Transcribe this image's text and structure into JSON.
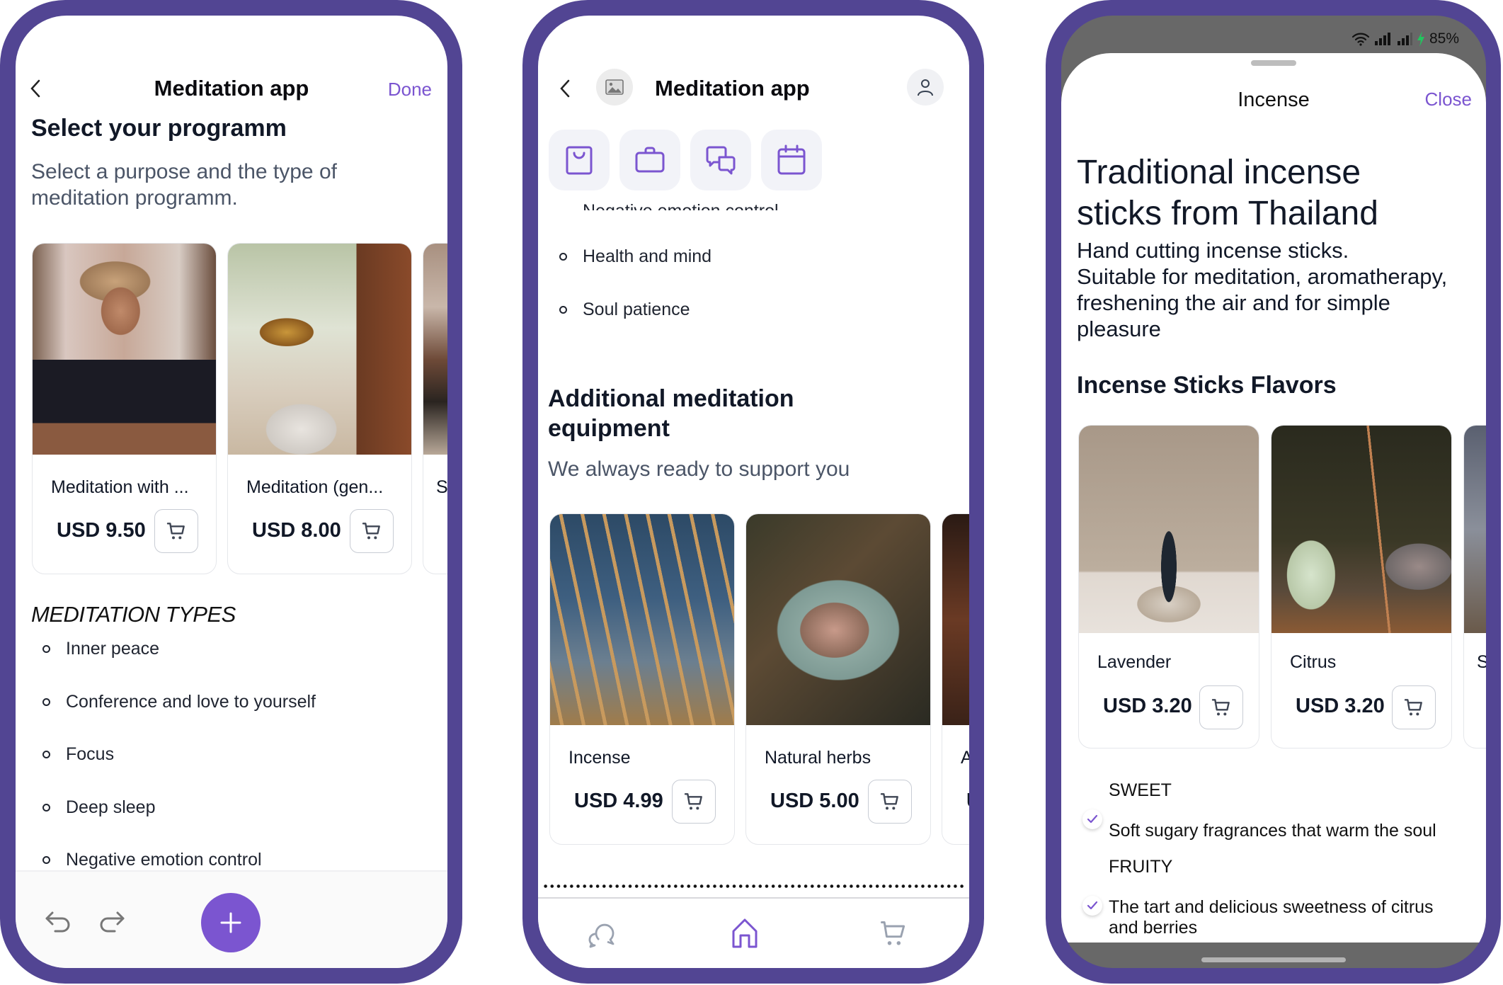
{
  "colors": {
    "frame": "#524593",
    "accent": "#7b55d0",
    "fab": "#7b55d0",
    "text_dark": "#111827",
    "text_muted": "#4b5567"
  },
  "phone1": {
    "nav": {
      "back_icon": "chevron-left-icon",
      "title": "Meditation app",
      "done_label": "Done"
    },
    "heading": "Select your programm",
    "subtitle": "Select a purpose and the type of meditation programm.",
    "programs": [
      {
        "name": "Meditation with ...",
        "price": "USD 9.50",
        "image": "woman-meditating-hand-on-chest"
      },
      {
        "name": "Meditation (gen...",
        "price": "USD 8.00",
        "image": "singing-bowl"
      },
      {
        "name": "S",
        "price": "",
        "image": "partial-figure"
      }
    ],
    "types_heading": "MEDITATION TYPES",
    "types": [
      "Inner peace",
      "Conference and love to yourself",
      "Focus",
      "Deep sleep",
      "Negative emotion control"
    ],
    "toolbar": {
      "undo_icon": "undo-icon",
      "redo_icon": "redo-icon",
      "add_icon": "plus-icon"
    }
  },
  "phone2": {
    "nav": {
      "back_icon": "chevron-left-icon",
      "image_icon": "image-icon",
      "title": "Meditation app",
      "profile_icon": "user-icon"
    },
    "quick_actions": [
      "shopping-bag-icon",
      "briefcase-icon",
      "chat-icon",
      "calendar-icon"
    ],
    "cut_off_item": "Negative emotion control",
    "list": [
      "Health and mind",
      "Soul patience"
    ],
    "heading": "Additional meditation equipment",
    "subtitle": "We always ready to support you",
    "equipment": [
      {
        "name": "Incense",
        "price": "USD 4.99",
        "image": "incense-sticks"
      },
      {
        "name": "Natural herbs",
        "price": "USD 5.00",
        "image": "mortar-and-pestle"
      },
      {
        "name": "A",
        "price": "U",
        "image": "partial"
      }
    ],
    "bottom_nav": [
      {
        "icon": "chat-icon",
        "active": false
      },
      {
        "icon": "home-icon",
        "active": true
      },
      {
        "icon": "cart-icon",
        "active": false
      }
    ]
  },
  "phone3": {
    "status_bar": {
      "battery": "85%"
    },
    "sheet": {
      "title": "Incense",
      "close_label": "Close"
    },
    "heading": "Traditional incense sticks from Thailand",
    "description_lines": [
      "Hand cutting incense sticks.",
      "Suitable for meditation, aromatherapy,",
      "freshening the air and for simple",
      "pleasure"
    ],
    "flavors_heading": "Incense Sticks Flavors",
    "flavors": [
      {
        "name": "Lavender",
        "price": "USD 3.20",
        "image": "incense-cone"
      },
      {
        "name": "Citrus",
        "price": "USD 3.20",
        "image": "incense-stick-crystal"
      },
      {
        "name": "S",
        "price": "",
        "image": "partial"
      }
    ],
    "options": [
      {
        "title": "SWEET",
        "description": "Soft sugary fragrances that warm the soul",
        "checked": true
      },
      {
        "title": "FRUITY",
        "description": "The tart and delicious sweetness of citrus and berries",
        "checked": true
      }
    ]
  }
}
